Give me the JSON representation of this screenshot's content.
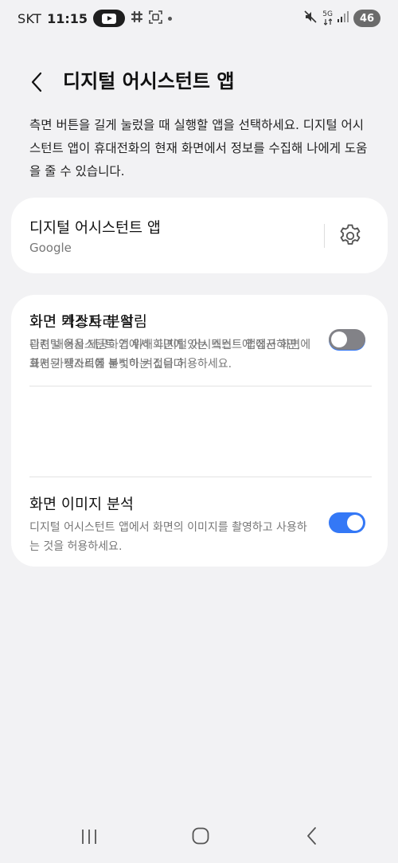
{
  "status_bar": {
    "carrier": "SKT",
    "time": "11:15",
    "network": "5G",
    "battery": "46",
    "icons": [
      "youtube-icon",
      "slack-icon",
      "screenshot-icon",
      "notification-dot-icon",
      "mute-icon",
      "signal-icon"
    ]
  },
  "header": {
    "title": "디지털 어시스턴트 앱",
    "back_icon": "chevron-left-icon"
  },
  "description": "측면 버튼을 길게 눌렀을 때 실행할 앱을 선택하세요. 디지털 어시스턴트 앱이 휴대전화의 현재 화면에서 정보를 수집해 나에게 도움을 줄 수 있습니다.",
  "assistant_card": {
    "title": "디지털 어시스턴트 앱",
    "value": "Google",
    "settings_icon": "gear-icon"
  },
  "options": [
    {
      "title": "화면 텍스트 분석",
      "description": "관련 내용을 제공하기 위해 디지털 어시스턴트 앱에서 화면에 표시된 텍스트를 분석하는 것을 허용하세요.",
      "enabled": true
    },
    {
      "title": "화면 이미지 분석",
      "description": "디지털 어시스턴트 앱에서 화면의 이미지를 촬영하고 사용하는 것을 허용하세요.",
      "enabled": true
    },
    {
      "title": "화면 가장자리 알림",
      "description": "디지털 어시스턴트 앱에서 화면에 있는 텍스트에 접근하면, 화면 가장자리에 불빛이 켜집니다.",
      "enabled": false
    }
  ],
  "colors": {
    "background": "#f2f2f4",
    "card": "#ffffff",
    "toggle_on": "#3478f6",
    "toggle_off": "#828287"
  },
  "nav_bar": {
    "icons": [
      "recents-icon",
      "home-icon",
      "back-icon"
    ]
  }
}
